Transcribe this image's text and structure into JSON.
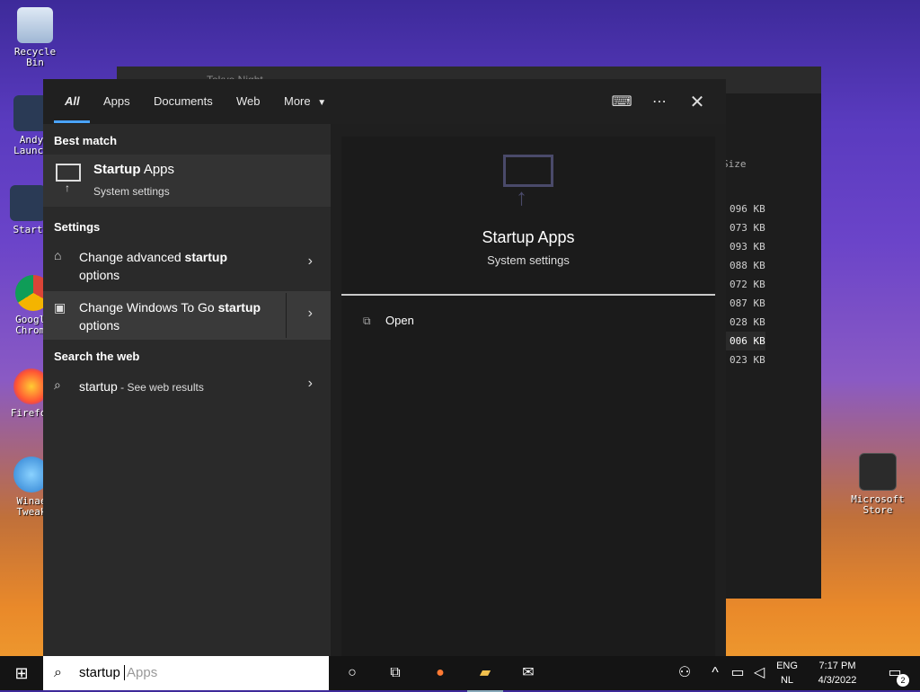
{
  "desktop": {
    "icons": [
      {
        "label": "Recycle Bin"
      },
      {
        "label": "Andy Launch"
      },
      {
        "label": "Start"
      },
      {
        "label": "Google Chrome"
      },
      {
        "label": "Firefox"
      },
      {
        "label": "Winae Tweak"
      },
      {
        "label": "Microsoft Store"
      }
    ]
  },
  "bg_window": {
    "title": "Tokyo Night",
    "size_header": "Size",
    "sizes": [
      "096 KB",
      "073 KB",
      "093 KB",
      "088 KB",
      "072 KB",
      "087 KB",
      "028 KB",
      "006 KB",
      "023 KB"
    ]
  },
  "search_panel": {
    "tabs": [
      "All",
      "Apps",
      "Documents",
      "Web",
      "More"
    ],
    "header_icons": [
      "feedback-icon",
      "more-icon",
      "close-icon"
    ],
    "best_match_label": "Best match",
    "best_match": {
      "title_bold": "Startup",
      "title_rest": " Apps",
      "subtitle": "System settings"
    },
    "settings_label": "Settings",
    "settings_items": [
      {
        "line1": "Change advanced ",
        "bold": "startup",
        "line2": "options"
      },
      {
        "line1": "Change Windows To Go ",
        "bold": "startup",
        "line2": "options"
      }
    ],
    "web_label": "Search the web",
    "web_item": {
      "query": "startup",
      "suffix": " - See web results"
    },
    "preview": {
      "title": "Startup Apps",
      "subtitle": "System settings",
      "action": "Open"
    }
  },
  "taskbar": {
    "search_text": "startup",
    "search_suggest": "Apps",
    "lang_top": "ENG",
    "lang_bottom": "NL",
    "time": "7:17 PM",
    "date": "4/3/2022",
    "notifications": "2"
  }
}
